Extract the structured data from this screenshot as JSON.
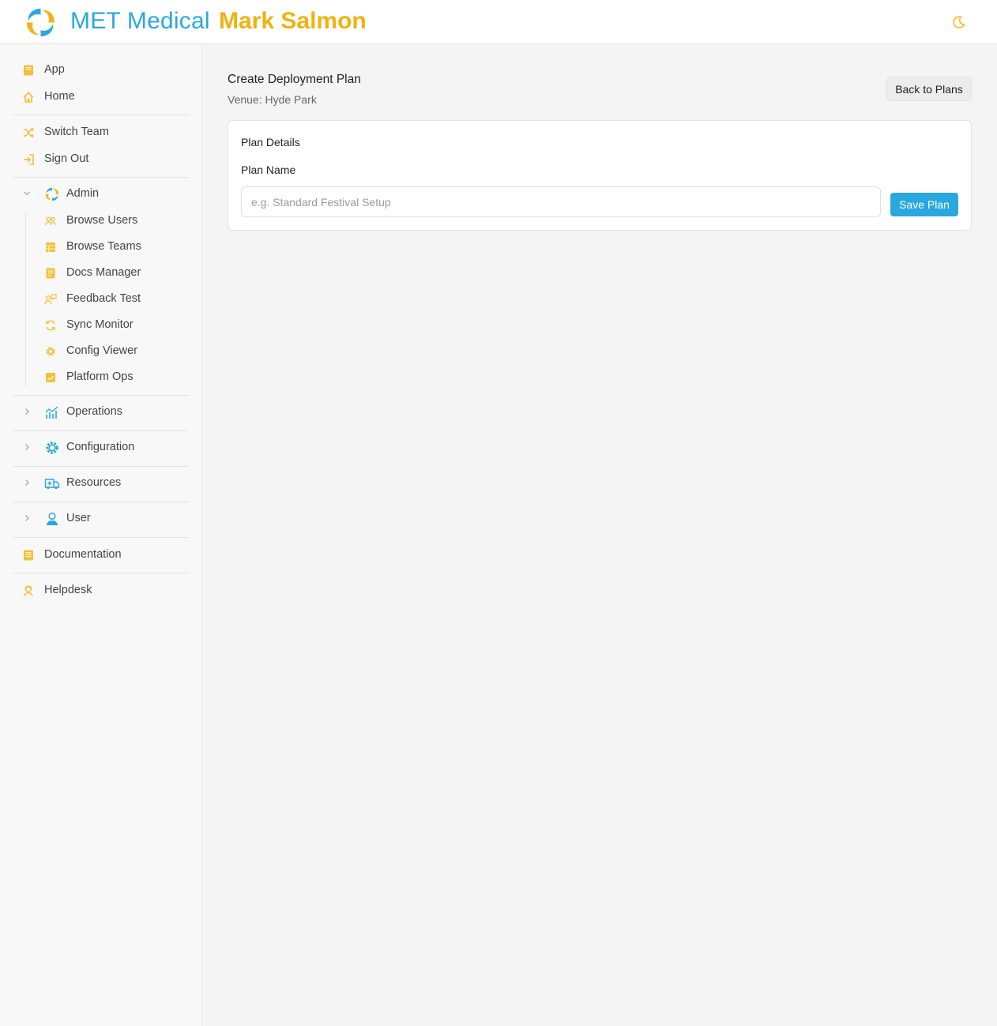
{
  "header": {
    "brand": "MET Medical",
    "user_name": "Mark Salmon",
    "logo_icon": "swirl-logo-icon",
    "theme_icon": "moon-icon"
  },
  "sidebar": {
    "top_items": [
      {
        "label": "App",
        "icon": "book-icon"
      },
      {
        "label": "Home",
        "icon": "home-icon"
      }
    ],
    "account_items": [
      {
        "label": "Switch Team",
        "icon": "shuffle-icon"
      },
      {
        "label": "Sign Out",
        "icon": "sign-out-icon"
      }
    ],
    "admin": {
      "label": "Admin",
      "expanded": true,
      "items": [
        {
          "label": "Browse Users",
          "icon": "users-icon"
        },
        {
          "label": "Browse Teams",
          "icon": "table-icon"
        },
        {
          "label": "Docs Manager",
          "icon": "document-icon"
        },
        {
          "label": "Feedback Test",
          "icon": "feedback-icon"
        },
        {
          "label": "Sync Monitor",
          "icon": "sync-icon"
        },
        {
          "label": "Config Viewer",
          "icon": "gear-icon"
        },
        {
          "label": "Platform Ops",
          "icon": "chart-box-icon"
        }
      ]
    },
    "groups": [
      {
        "label": "Operations",
        "icon": "chart-icon"
      },
      {
        "label": "Configuration",
        "icon": "gear-icon"
      },
      {
        "label": "Resources",
        "icon": "ambulance-icon"
      },
      {
        "label": "User",
        "icon": "user-icon"
      }
    ],
    "bottom_items": [
      {
        "label": "Documentation",
        "icon": "book-icon"
      },
      {
        "label": "Helpdesk",
        "icon": "support-agent-icon"
      }
    ]
  },
  "main": {
    "title": "Create Deployment Plan",
    "venue": "Venue: Hyde Park",
    "back_label": "Back to Plans",
    "card": {
      "title": "Plan Details",
      "field_label": "Plan Name",
      "placeholder": "e.g. Standard Festival Setup",
      "value": "",
      "save_label": "Save Plan"
    }
  },
  "colors": {
    "brand_blue": "#29a8e0",
    "accent_gold": "#f0b20f",
    "icon_yellow": "#f3c03b"
  }
}
